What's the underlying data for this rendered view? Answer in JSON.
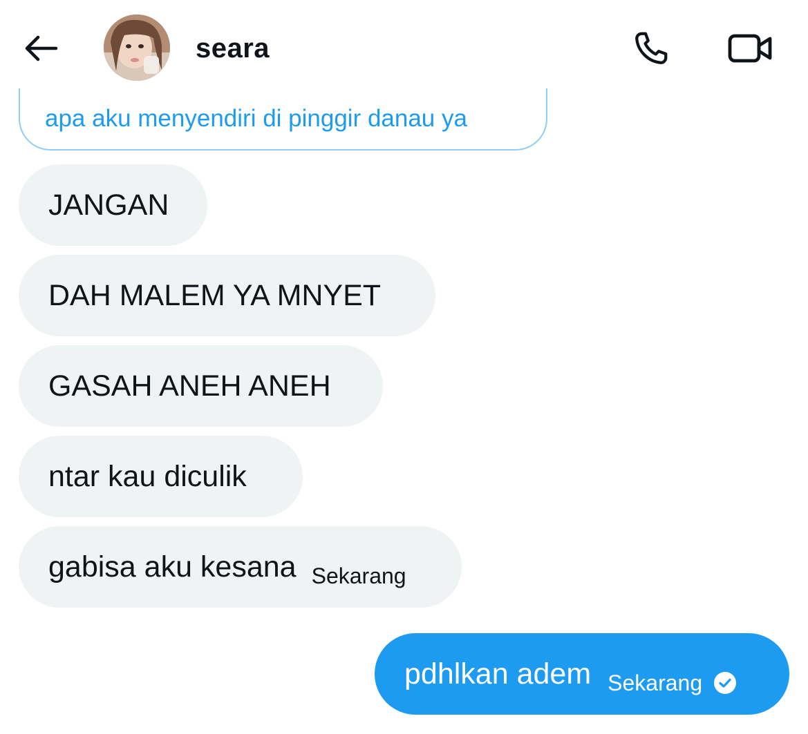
{
  "header": {
    "back_icon": "arrow-left-icon",
    "contact_name": "seara",
    "call_icon": "phone-icon",
    "video_icon": "video-camera-icon"
  },
  "quoted_message": {
    "text": "apa aku menyendiri di pinggir danau ya"
  },
  "received_messages": [
    {
      "text": "JANGAN",
      "time": ""
    },
    {
      "text": "DAH MALEM YA MNYET",
      "time": ""
    },
    {
      "text": "GASAH ANEH ANEH",
      "time": ""
    },
    {
      "text": "ntar kau diculik",
      "time": ""
    },
    {
      "text": "gabisa aku kesana",
      "time": "Sekarang"
    }
  ],
  "sent_message": {
    "text": "pdhlkan adem",
    "time": "Sekarang",
    "status_icon": "check-circle-icon"
  },
  "colors": {
    "accent": "#1d9bf0",
    "received_bubble": "#eff3f4",
    "text": "#0f1419"
  }
}
